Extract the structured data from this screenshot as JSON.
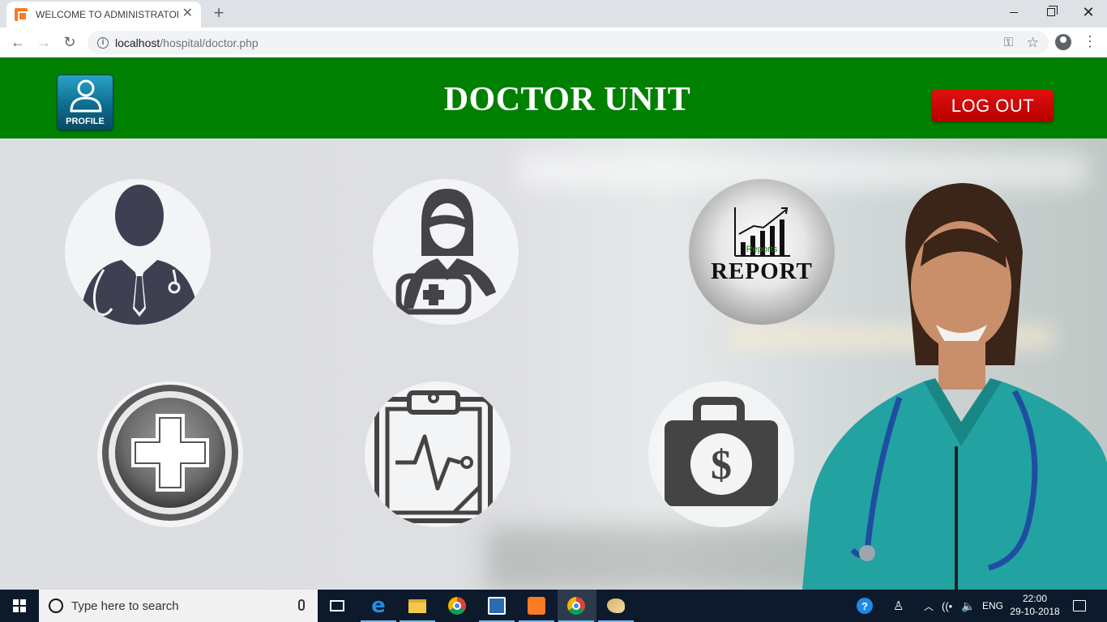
{
  "browser": {
    "tab_title": "WELCOME TO ADMINISTRATOR U",
    "new_tab_symbol": "+",
    "url_host": "localhost",
    "url_path": "/hospital/doctor.php",
    "window_controls": [
      "minimize-icon",
      "restore-icon",
      "close-icon"
    ]
  },
  "header": {
    "profile_label": "PROFILE",
    "title": "DOCTOR UNIT",
    "logout_label": "LOG OUT",
    "color": "#008000"
  },
  "tiles": [
    {
      "icon": "doctor-icon"
    },
    {
      "icon": "nurse-icon"
    },
    {
      "icon": "report-icon",
      "small_text": "Reports",
      "label": "REPORT"
    },
    {
      "icon": "medical-cross-icon"
    },
    {
      "icon": "clipboard-heartbeat-icon"
    },
    {
      "icon": "money-bag-icon"
    }
  ],
  "taskbar": {
    "search_placeholder": "Type here to search",
    "language": "ENG",
    "time": "22:00",
    "date": "29-10-2018"
  }
}
